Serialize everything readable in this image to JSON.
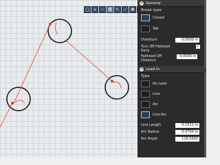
{
  "toolbar": {
    "buttons": [
      "zoom-extents-icon",
      "zoom-in-icon",
      "zoom-out-icon",
      "pan-icon",
      "select-icon",
      "measure-icon",
      "settings-icon",
      "ruler-icon"
    ]
  },
  "panel": {
    "general": {
      "title": "General",
      "break_type_label": "Break type",
      "options": [
        {
          "label": "Closed",
          "selected": true
        },
        {
          "label": "Tab",
          "selected": false
        }
      ],
      "overburn_label": "Overburn",
      "overburn_value": "0.0500 in",
      "turn_off_label": "Turn Off Fabhead Early",
      "turn_off_checked": "✓",
      "fabhead_off_label": "Fabhead Off Distance",
      "fabhead_off_value": "0.0000 in"
    },
    "lead_in": {
      "title": "Lead In",
      "type_label": "Type",
      "options": [
        {
          "label": "No Lead",
          "selected": false
        },
        {
          "label": "Line",
          "selected": false
        },
        {
          "label": "Arc",
          "selected": false
        },
        {
          "label": "Line-Arc",
          "selected": true
        }
      ],
      "line_length_label": "Line Length",
      "line_length_value": "0.1511 in",
      "arc_radius_label": "Arc Radius",
      "arc_radius_value": "0.0700 in",
      "arc_angle_label": "Arc Angle",
      "arc_angle_value": "118.0000"
    }
  },
  "colors": {
    "path": "#e04020",
    "circle": "#111111",
    "accent": "#9fc6ec"
  }
}
